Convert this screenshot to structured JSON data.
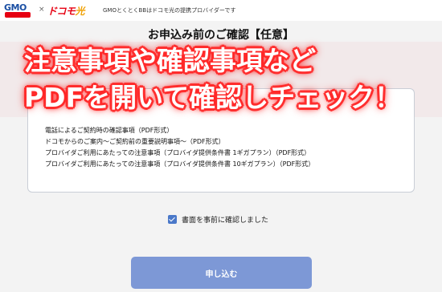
{
  "header": {
    "logo_text": "GMO",
    "separator": "×",
    "docomo_logo": "ドコモ",
    "hikari": "光",
    "tagline": "GMOとくとくBBはドコモ光の提携プロバイダーです"
  },
  "page_title": "お申込み前のご確認【任意】",
  "overlay": {
    "line1": "注意事項や確認事項など",
    "line2": "PDFを開いて確認しチェック！"
  },
  "documents": [
    "電話によるご契約時の確認事項（PDF形式）",
    "ドコモからのご案内～ご契約前の重要説明事項～（PDF形式）",
    "プロバイダご利用にあたっての注意事項（プロバイダ提供条件書 1ギガプラン）（PDF形式）",
    "プロバイダご利用にあたっての注意事項（プロバイダ提供条件書 10ギガプラン）（PDF形式）"
  ],
  "confirm": {
    "label": "書面を事前に確認しました",
    "checked": true
  },
  "submit_label": "申し込む",
  "colors": {
    "accent": "#4a78c9",
    "button": "#7d98d6",
    "overlay_glow": "#ff2b2b"
  }
}
